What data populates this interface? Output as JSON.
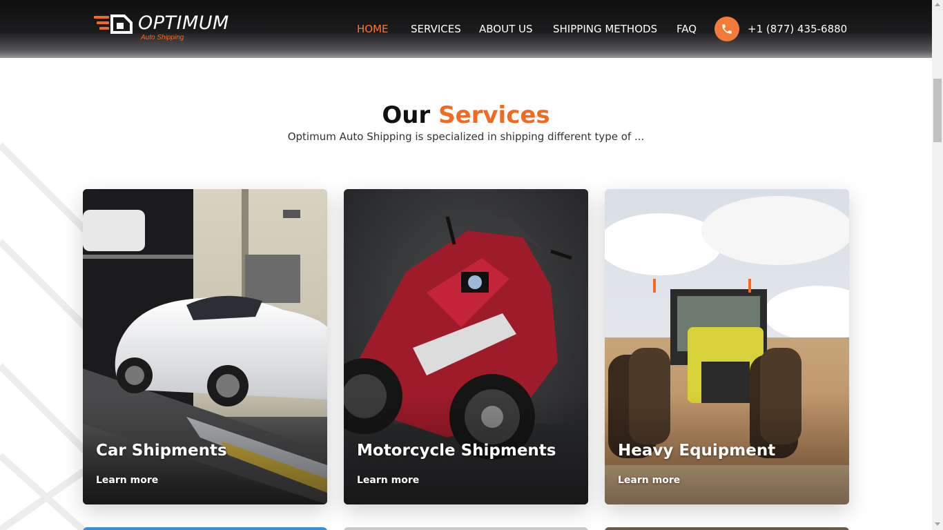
{
  "header": {
    "logo": {
      "word": "OPTIMUM",
      "tagline": "Auto Shipping"
    },
    "nav": [
      {
        "label": "HOME",
        "active": true
      },
      {
        "label": "SERVICES",
        "active": false
      },
      {
        "label": "ABOUT US",
        "active": false
      },
      {
        "label": "SHIPPING METHODS",
        "active": false
      },
      {
        "label": "FAQ",
        "active": false
      }
    ],
    "phone_icon": "phone-icon",
    "phone": "+1 (877) 435-6880"
  },
  "section": {
    "title_part1": "Our",
    "title_part2": "Services",
    "subtitle": "Optimum Auto Shipping is specialized in shipping different type of ..."
  },
  "cards": [
    {
      "title": "Car Shipments",
      "link": "Learn more"
    },
    {
      "title": "Motorcycle Shipments",
      "link": "Learn more"
    },
    {
      "title": "Heavy Equipment",
      "link": "Learn more"
    }
  ],
  "colors": {
    "accent": "#f26a21",
    "header_bg": "#1a1a1c",
    "text": "#111111"
  }
}
